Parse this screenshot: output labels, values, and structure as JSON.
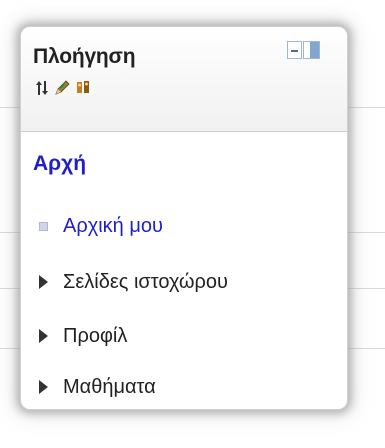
{
  "navigation_block": {
    "title": "Πλοήγηση",
    "controls": {
      "minimize_icon": "minus-box-icon",
      "dock_icon": "dock-panel-icon"
    },
    "edit_icons": [
      "move-icon",
      "edit-icon",
      "assign-roles-icon"
    ],
    "home": "Αρχή",
    "items": [
      {
        "label": "Αρχική μου",
        "bullet": "square",
        "link": true
      },
      {
        "label": "Σελίδες ιστοχώρου",
        "bullet": "arrow",
        "link": false
      },
      {
        "label": "Προφίλ",
        "bullet": "arrow",
        "link": false
      },
      {
        "label": "Μαθήματα",
        "bullet": "arrow",
        "link": false
      }
    ]
  },
  "colors": {
    "link": "#1f1fc9",
    "text": "#222222",
    "border": "#d0d0d0"
  }
}
